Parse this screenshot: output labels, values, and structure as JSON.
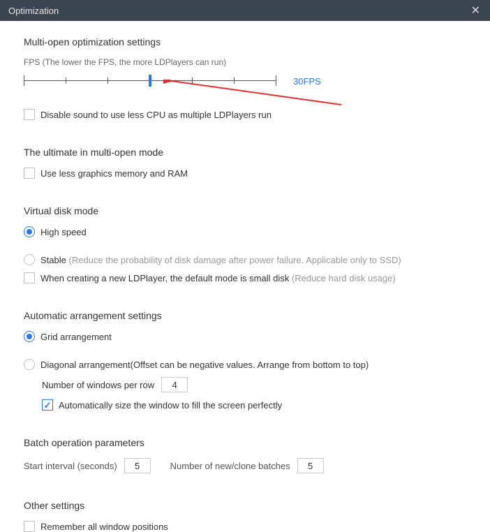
{
  "titlebar": {
    "title": "Optimization"
  },
  "multiOpen": {
    "title": "Multi-open optimization settings",
    "fpsHint": "FPS (The lower the FPS, the more LDPlayers can run)",
    "fpsValue": "30FPS",
    "disableSound": "Disable sound to use less CPU as multiple LDPlayers run"
  },
  "ultimate": {
    "title": "The ultimate in multi-open mode",
    "lessMem": "Use less graphics memory and RAM"
  },
  "virtualDisk": {
    "title": "Virtual disk mode",
    "highSpeed": "High speed",
    "stable": "Stable",
    "stableHint": "(Reduce the probability of disk damage after power failure. Applicable only to SSD)",
    "smallDisk": "When creating a new LDPlayer, the default mode is small disk",
    "smallDiskHint": "(Reduce hard disk usage)"
  },
  "arrange": {
    "title": "Automatic arrangement settings",
    "grid": "Grid arrangement",
    "diagonal": "Diagonal arrangement(Offset can be negative values. Arrange from bottom to top)",
    "perRowLabel": "Number of windows per row",
    "perRowValue": "4",
    "autoSize": "Automatically size the window to fill the screen perfectly"
  },
  "batch": {
    "title": "Batch operation parameters",
    "startInterval": "Start interval (seconds)",
    "startIntervalValue": "5",
    "batchesLabel": "Number of new/clone batches",
    "batchesValue": "5"
  },
  "other": {
    "title": "Other settings",
    "rememberPos": "Remember all window positions"
  }
}
